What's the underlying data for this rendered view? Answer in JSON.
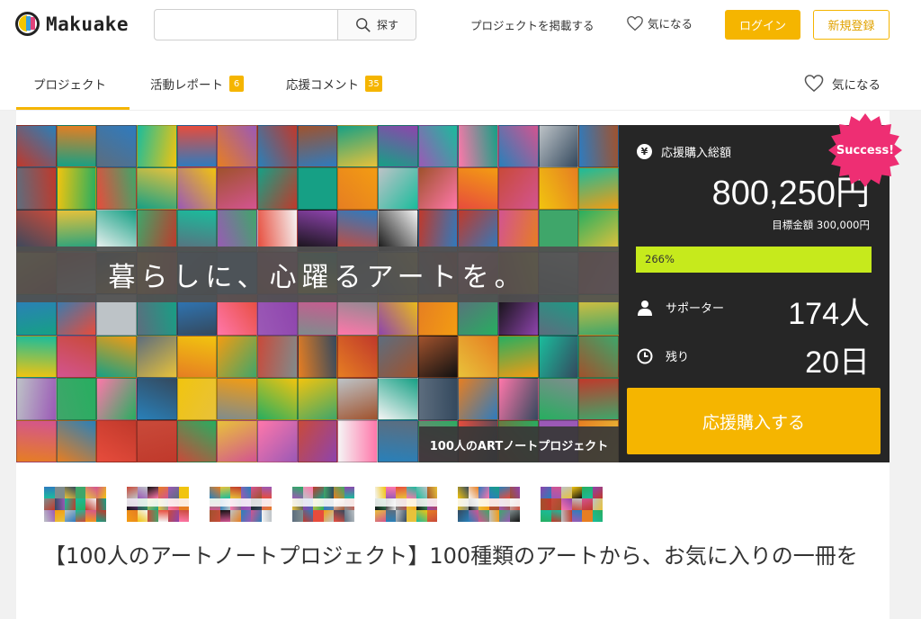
{
  "header": {
    "logo_text": "Makuake",
    "search": {
      "placeholder": "",
      "value": "",
      "button_label": "探す"
    },
    "post_project_label": "プロジェクトを掲載する",
    "favorites_label": "気になる",
    "login_label": "ログイン",
    "signup_label": "新規登録"
  },
  "tabs": {
    "items": [
      {
        "label": "プロジェクト",
        "badge": ""
      },
      {
        "label": "活動レポート",
        "badge": "6"
      },
      {
        "label": "応援コメント",
        "badge": "35"
      }
    ],
    "active_index": 0,
    "favorite_label": "気になる"
  },
  "hero": {
    "headline": "暮らしに、心躍るアートを。",
    "corner_label": "100人のARTノートプロジェクト"
  },
  "stats": {
    "total_label": "応援購入総額",
    "total_amount": "800,250円",
    "goal_text": "目標金額 300,000円",
    "progress_text": "266%",
    "progress_fraction": 1.0,
    "supporters_label": "サポーター",
    "supporters_value": "174人",
    "remaining_label": "残り",
    "remaining_value": "20日",
    "buy_label": "応援購入する",
    "success_label": "Success!"
  },
  "colors": {
    "accent": "#f5b500",
    "progress": "#c6ea1c",
    "panel": "#262626",
    "success_badge": "#ee2e73"
  },
  "title": "【100人のアートノートプロジェクト】100種類のアートから、お気に入りの一冊を"
}
